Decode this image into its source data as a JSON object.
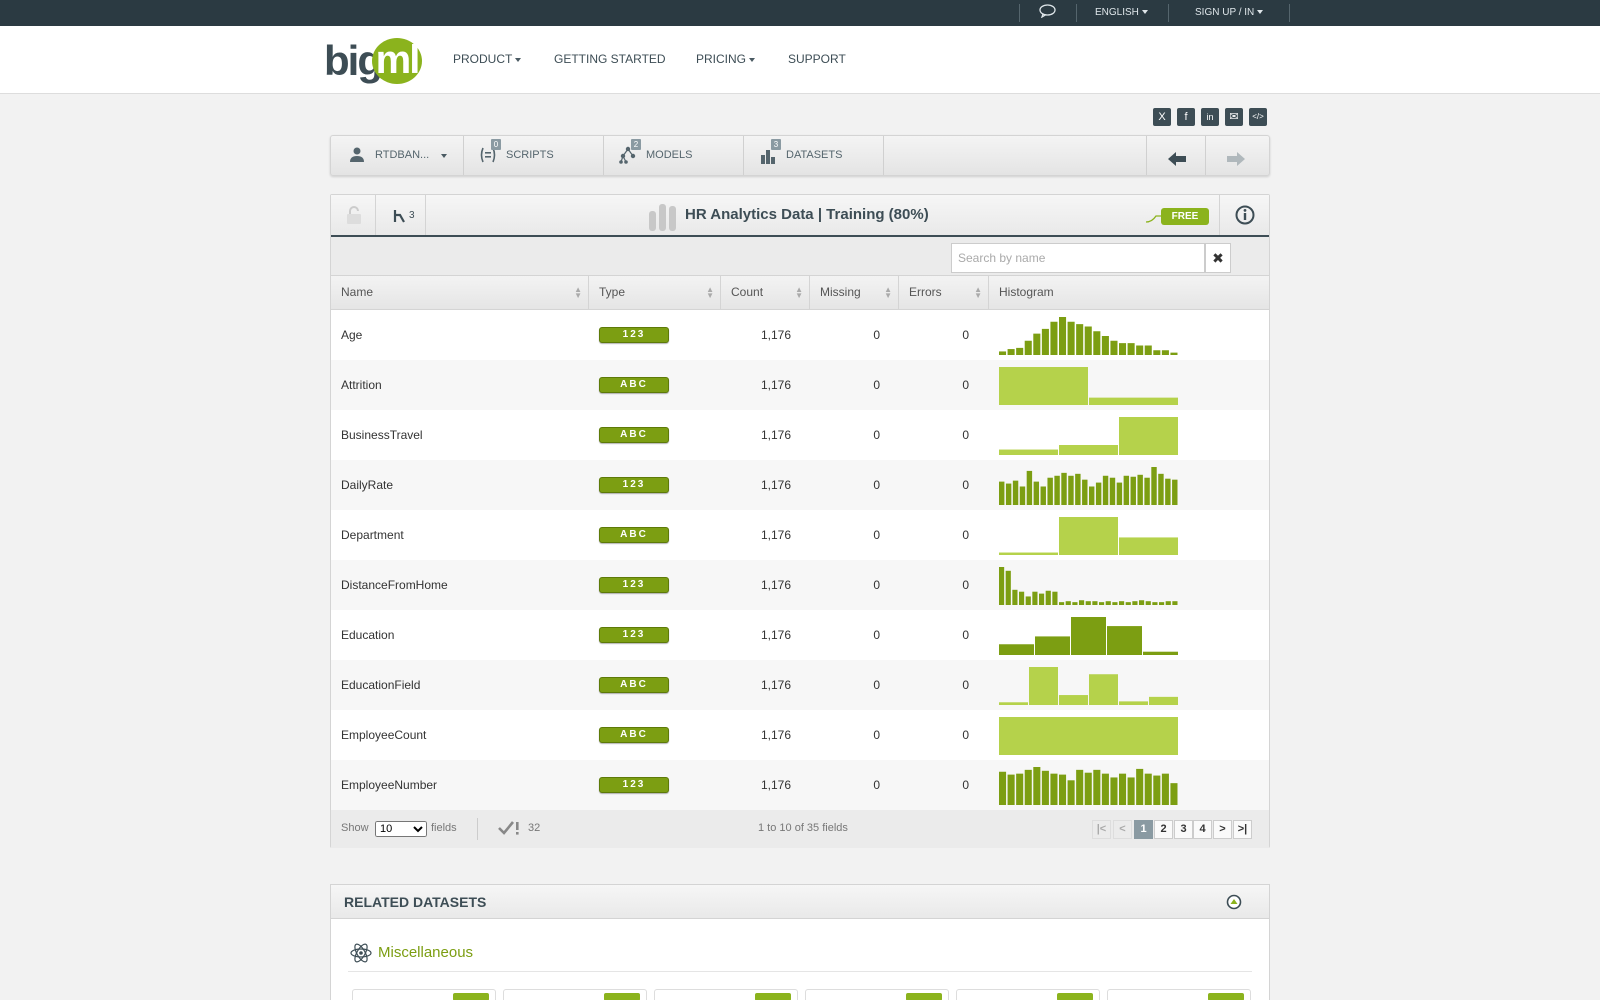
{
  "topbar": {
    "language": "ENGLISH",
    "signup": "SIGN UP / IN"
  },
  "header": {
    "logo_big": "big",
    "logo_ml": "ml",
    "nav": [
      "PRODUCT",
      "GETTING STARTED",
      "PRICING",
      "SUPPORT"
    ]
  },
  "share": [
    "X",
    "f",
    "in",
    "✉",
    "</>"
  ],
  "resources": {
    "user": "RTDBAN...",
    "scripts": {
      "label": "SCRIPTS",
      "count": "0"
    },
    "models": {
      "label": "MODELS",
      "count": "2"
    },
    "datasets": {
      "label": "DATASETS",
      "count": "3"
    }
  },
  "dataset": {
    "title": "HR Analytics Data | Training (80%)",
    "free_label": "FREE",
    "sources_count": "3",
    "search_placeholder": "Search by name"
  },
  "columns": [
    "Name",
    "Type",
    "Count",
    "Missing",
    "Errors",
    "Histogram"
  ],
  "fields": [
    {
      "name": "Age",
      "type": "123",
      "count": "1,176",
      "missing": "0",
      "errors": "0",
      "hist_dark": true,
      "hist": [
        3,
        5,
        6,
        12,
        18,
        22,
        28,
        32,
        28,
        26,
        24,
        20,
        16,
        12,
        10,
        10,
        8,
        8,
        4,
        4,
        2
      ]
    },
    {
      "name": "Attrition",
      "type": "ABC",
      "count": "1,176",
      "missing": "0",
      "errors": "0",
      "hist_dark": false,
      "hist": [
        985,
        191
      ]
    },
    {
      "name": "BusinessTravel",
      "type": "ABC",
      "count": "1,176",
      "missing": "0",
      "errors": "0",
      "hist_dark": false,
      "hist": [
        120,
        220,
        836
      ]
    },
    {
      "name": "DailyRate",
      "type": "123",
      "count": "1,176",
      "missing": "0",
      "errors": "0",
      "hist_dark": true,
      "hist": [
        24,
        22,
        25,
        19,
        35,
        24,
        19,
        28,
        30,
        33,
        30,
        32,
        26,
        19,
        23,
        30,
        28,
        23,
        30,
        29,
        31,
        28,
        39,
        32,
        27,
        26
      ]
    },
    {
      "name": "Department",
      "type": "ABC",
      "count": "1,176",
      "missing": "0",
      "errors": "0",
      "hist_dark": false,
      "hist": [
        50,
        770,
        356
      ]
    },
    {
      "name": "DistanceFromHome",
      "type": "123",
      "count": "1,176",
      "missing": "0",
      "errors": "0",
      "hist_dark": true,
      "hist": [
        40,
        36,
        16,
        14,
        9,
        14,
        12,
        15,
        14,
        3,
        4,
        3,
        5,
        4,
        4,
        3,
        4,
        3,
        4,
        3,
        4,
        5,
        4,
        3,
        3,
        4,
        4
      ]
    },
    {
      "name": "Education",
      "type": "123",
      "count": "1,176",
      "missing": "0",
      "errors": "0",
      "hist_dark": true,
      "hist": [
        130,
        225,
        460,
        350,
        40
      ]
    },
    {
      "name": "EducationField",
      "type": "ABC",
      "count": "1,176",
      "missing": "0",
      "errors": "0",
      "hist_dark": false,
      "hist": [
        30,
        420,
        110,
        340,
        40,
        90
      ]
    },
    {
      "name": "EmployeeCount",
      "type": "ABC",
      "count": "1,176",
      "missing": "0",
      "errors": "0",
      "hist_dark": false,
      "hist": [
        1176
      ]
    },
    {
      "name": "EmployeeNumber",
      "type": "123",
      "count": "1,176",
      "missing": "0",
      "errors": "0",
      "hist_dark": true,
      "hist": [
        35,
        32,
        33,
        37,
        40,
        36,
        33,
        32,
        26,
        37,
        34,
        37,
        33,
        29,
        33,
        29,
        38,
        33,
        31,
        33,
        23
      ]
    }
  ],
  "footer": {
    "show_label": "Show",
    "show_value": "10",
    "fields_label": "fields",
    "check_count": "32",
    "range_text": "1 to 10 of 35 fields",
    "pages": [
      "1",
      "2",
      "3",
      "4"
    ]
  },
  "related": {
    "title": "RELATED DATASETS",
    "category": "Miscellaneous"
  },
  "colors": {
    "dark_bar": "#7c9e12",
    "light_bar": "#b5d24b",
    "accent": "#8bb31d"
  }
}
